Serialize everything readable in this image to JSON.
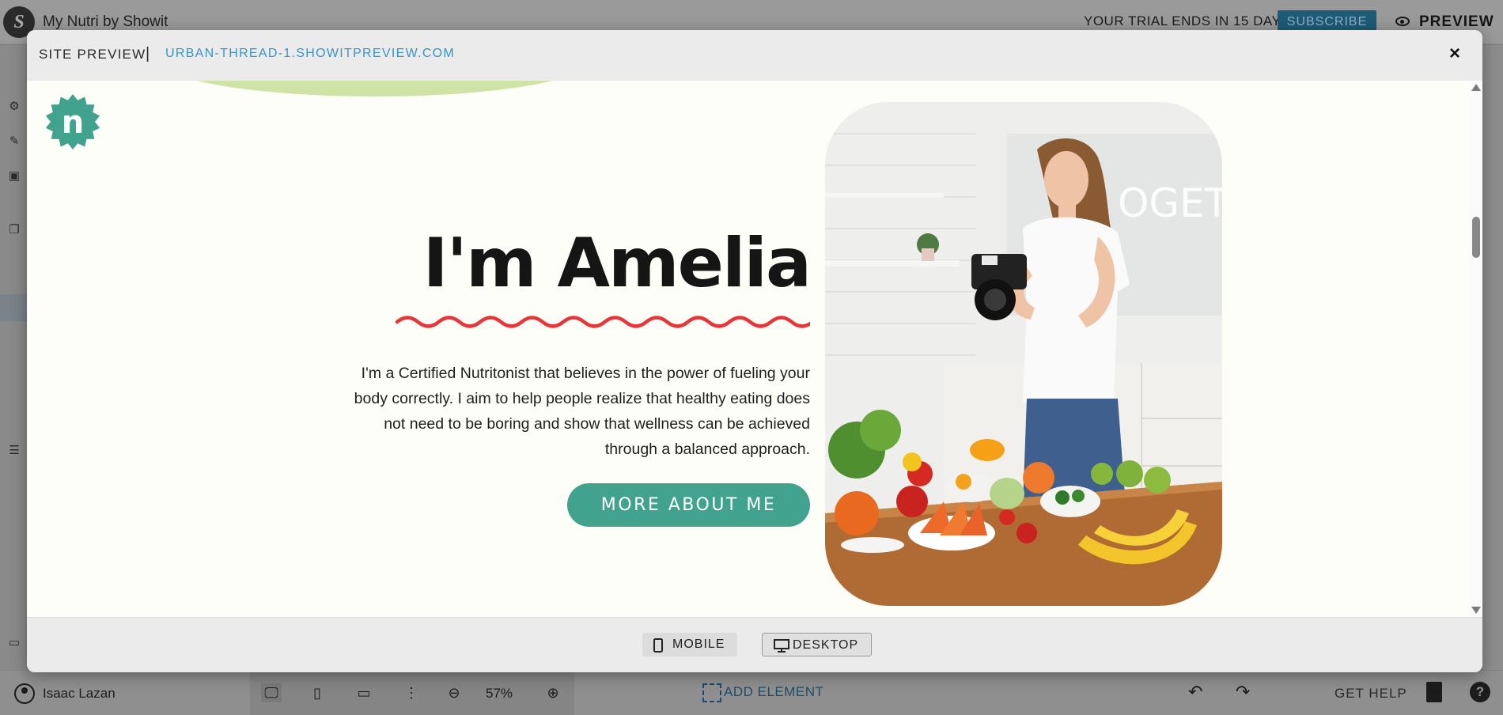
{
  "app": {
    "name": "My Nutri by Showit",
    "trial_text": "YOUR TRIAL ENDS IN 15 DAYS",
    "subscribe_label": "SUBSCRIBE",
    "preview_label": "PREVIEW"
  },
  "modal": {
    "title": "SITE PREVIEW",
    "separator": "|",
    "url": "URBAN-THREAD-1.SHOWITPREVIEW.COM",
    "close_label": "×"
  },
  "site": {
    "logo_letter": "n",
    "heading": "I'm Amelia",
    "body": "I'm a Certified Nutritonist that believes in the power of fueling your body correctly. I aim to help people realize that healthy eating does not need to be boring and show that wellness can be achieved through a balanced approach.",
    "button_label": "MORE ABOUT ME",
    "colors": {
      "teal": "#41a28d",
      "wave_red": "#e8353a",
      "background": "#fefef8",
      "arc_green": "#cfe3a6"
    }
  },
  "preview_footer": {
    "mobile_label": "MOBILE",
    "desktop_label": "DESKTOP"
  },
  "bottom_bar": {
    "user_name": "Isaac Lazan",
    "zoom": "57%",
    "add_element_label": "ADD ELEMENT",
    "help_label": "GET HELP"
  }
}
